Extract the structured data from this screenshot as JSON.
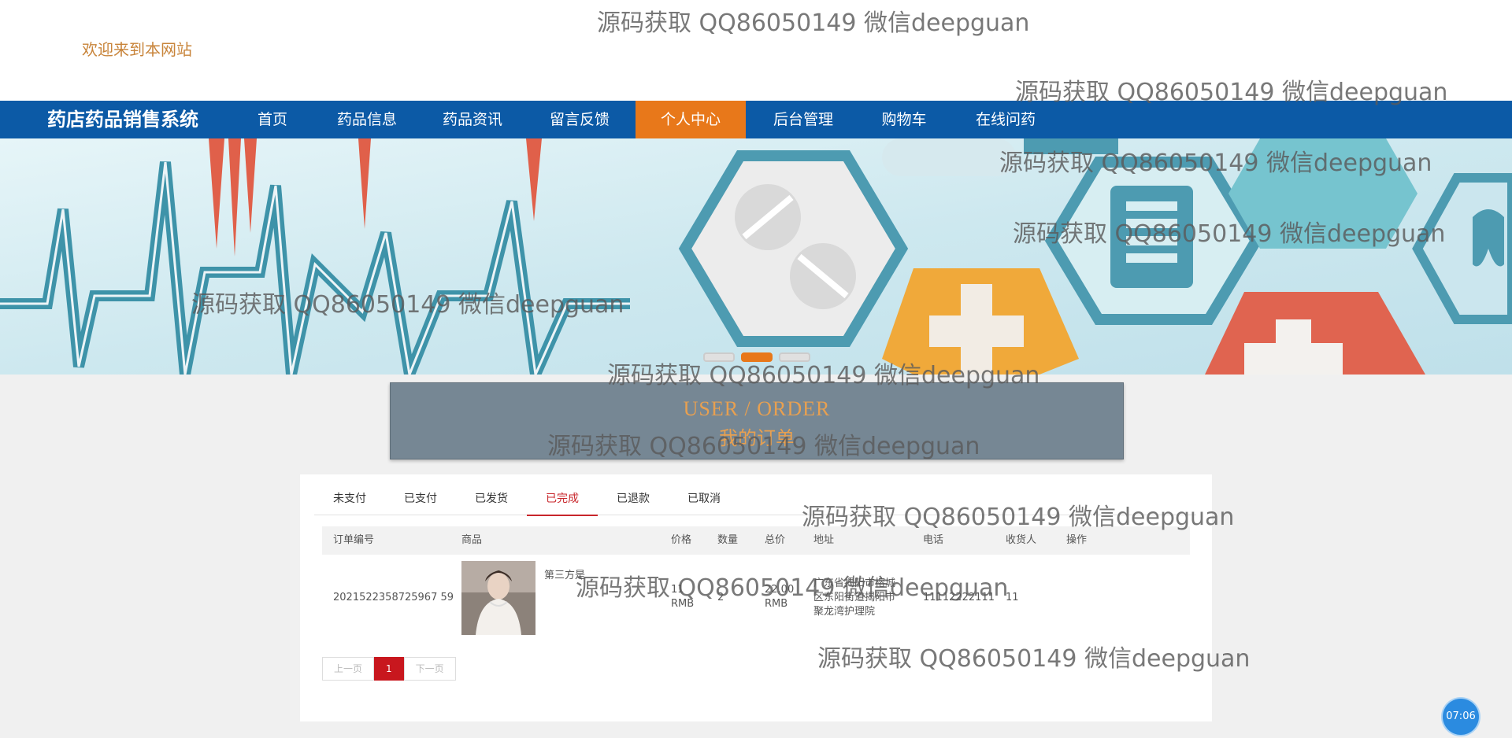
{
  "header": {
    "welcome": "欢迎来到本网站"
  },
  "nav": {
    "brand": "药店药品销售系统",
    "items": [
      "首页",
      "药品信息",
      "药品资讯",
      "留言反馈",
      "个人中心",
      "后台管理",
      "购物车",
      "在线问药"
    ],
    "active": "个人中心",
    "active_color": "#e8781a",
    "bar_color": "#0c5aa6"
  },
  "banner": {
    "active_slide": 2,
    "slide_count": 3
  },
  "order_header": {
    "en": "USER / ORDER",
    "cn": "我的订单"
  },
  "tabs": [
    "未支付",
    "已支付",
    "已发货",
    "已完成",
    "已退款",
    "已取消"
  ],
  "active_tab": "已完成",
  "table": {
    "columns": [
      "订单编号",
      "商品",
      "价格",
      "数量",
      "总价",
      "地址",
      "电话",
      "收货人",
      "操作"
    ],
    "rows": [
      {
        "order_no": "2021522358725967 59",
        "product": "第三方是",
        "price": "11",
        "price_unit": "RMB",
        "qty": "2",
        "total": "22.00",
        "total_unit": "RMB",
        "addr1": "广东省揭阳市榕城",
        "addr2": "区东阳街道揭阳市",
        "addr3": "聚龙湾护理院",
        "phone": "11112222111",
        "receiver": "11"
      }
    ]
  },
  "pager": {
    "prev": "上一页",
    "current": "1",
    "next": "下一页"
  },
  "clock": "07:06",
  "watermark": "源码获取 QQ86050149 微信deepguan"
}
